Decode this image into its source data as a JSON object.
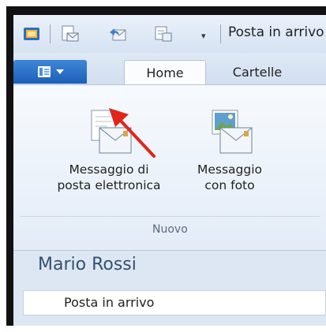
{
  "window": {
    "title": "Posta in arrivo"
  },
  "quick_access": {
    "icons": [
      "outlook-app-icon",
      "new-mail-icon",
      "reply-icon",
      "calendar-icon"
    ],
    "dropdown": "▾"
  },
  "tabs": {
    "file_menu_icon": "app-menu-icon",
    "items": [
      {
        "label": "Home",
        "active": true
      },
      {
        "label": "Cartelle",
        "active": false
      }
    ]
  },
  "ribbon": {
    "buttons": [
      {
        "line1": "Messaggio di",
        "line2": "posta elettronica",
        "icon": "email-message-icon"
      },
      {
        "line1": "Messaggio",
        "line2": "con foto",
        "icon": "photo-message-icon"
      }
    ],
    "group_label": "Nuovo"
  },
  "nav_pane": {
    "account_name": "Mario Rossi",
    "folder": "Posta in arrivo"
  },
  "colors": {
    "accent": "#1c5fb8",
    "annotation_arrow": "#e0251b",
    "ribbon_bg": "#eef3fa"
  }
}
